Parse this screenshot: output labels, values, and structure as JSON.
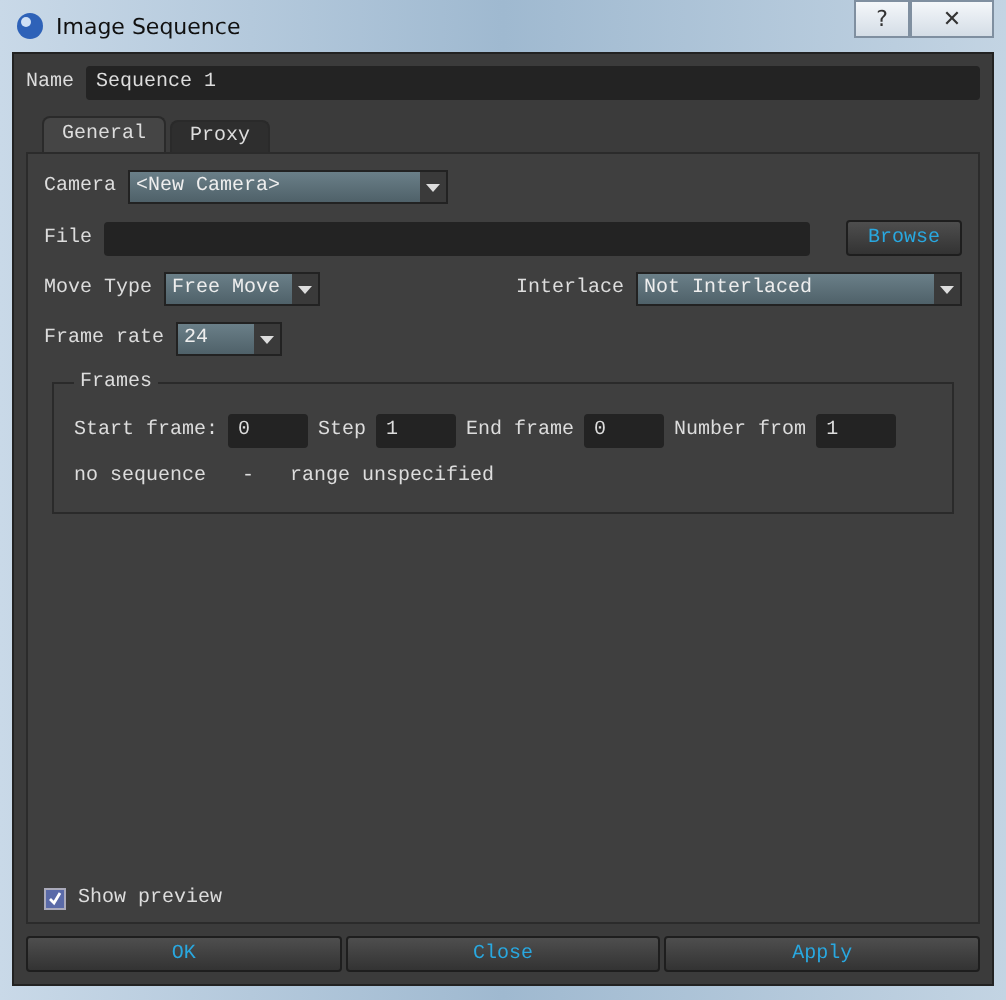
{
  "window": {
    "title": "Image Sequence",
    "buttons": [
      "?",
      "✕"
    ]
  },
  "name": {
    "label": "Name",
    "value": "Sequence 1"
  },
  "tabs": [
    {
      "label": "General",
      "selected": true
    },
    {
      "label": "Proxy",
      "selected": false
    }
  ],
  "camera": {
    "label": "Camera",
    "value": "<New Camera>"
  },
  "file": {
    "label": "File",
    "button": "Browse"
  },
  "move_type": {
    "label": "Move Type",
    "value": "Free Move"
  },
  "interlace": {
    "label": "Interlace",
    "value": "Not Interlaced"
  },
  "frame_rate": {
    "label": "Frame rate",
    "value": "24"
  },
  "frames": {
    "title": "Frames",
    "fields": [
      {
        "label": "Start frame:",
        "value": "0"
      },
      {
        "label": "Step",
        "value": "1"
      },
      {
        "label": "End frame",
        "value": "0"
      },
      {
        "label": "Number from",
        "value": "1"
      }
    ],
    "status": [
      "no sequence",
      "-",
      "range unspecified"
    ]
  },
  "show_preview": {
    "label": "Show preview",
    "checked": true
  },
  "buttons": [
    "OK",
    "Close",
    "Apply"
  ]
}
